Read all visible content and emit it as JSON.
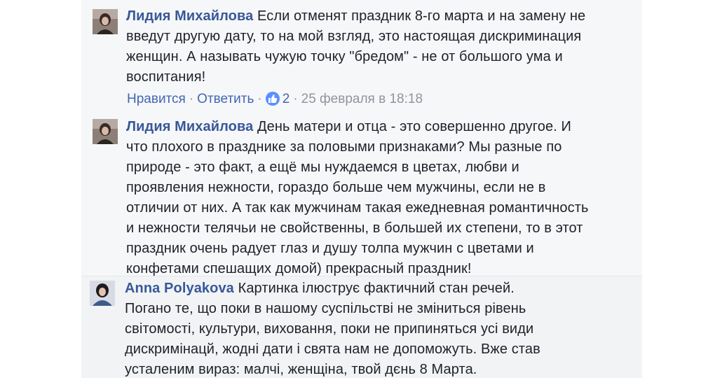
{
  "comments": [
    {
      "author": "Лидия Михайлова",
      "text": "Если отменят праздник 8-го марта и на замену не введут другую дату, то на мой взгляд, это настоящая дискриминация женщин. А называть чужую точку \"бредом\" - не от большого ума и воспитания!",
      "actions": {
        "like": "Нравится",
        "reply": "Ответить",
        "reaction_icon": "like-icon",
        "reaction_count": "2",
        "timestamp": "25 февраля в 18:18"
      }
    },
    {
      "author": "Лидия Михайлова",
      "text": "День матери и отца - это совершенно другое. И что плохого в празднике за половыми признаками? Мы разные по природе - это факт, а ещё мы нуждаемся в цветах, любви и проявления нежности, гораздо больше чем мужчины, если не в отличии от них. А так как мужчинам такая ежедневная романтичность и нежности телячьи не свойственны, в большей их степени, то в этот праздник очень радует глаз и душу толпа мужчин с цветами и конфетами спешащих домой) прекрасный праздник!"
    },
    {
      "author": "Anna Polyakova",
      "text": "Картинка ілюструє фактичний стан речей. Погано те, що поки в нашому суспільстві не зміниться рівень світомості, культури, виховання, поки не припиняться усі види дискримінацй, жодні дати і свята нам не допоможуть. Вже став усталеним вираз: малчі, женщіна, твой дєнь 8 Марта."
    }
  ],
  "colors": {
    "author": "#385898",
    "link": "#4267b2",
    "meta": "#90949c",
    "text": "#1d2129",
    "background": "#f6f7f9",
    "like_badge": "#5890ff"
  }
}
